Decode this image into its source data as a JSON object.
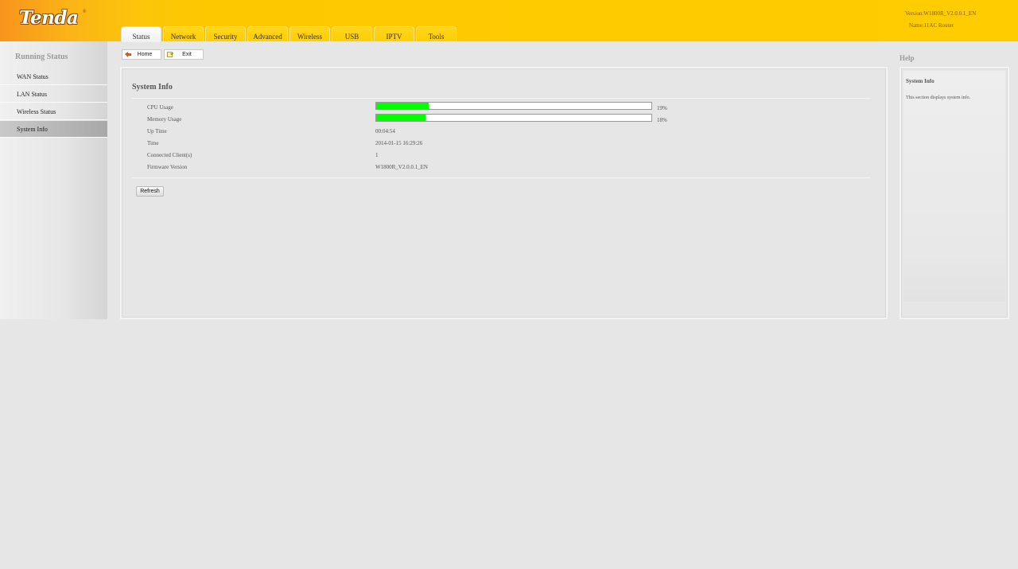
{
  "header": {
    "logo": "Tenda",
    "logo_mark": "®",
    "version": "Version:W1800R_V2.0.0.1_EN",
    "name": "Name:11AC Router"
  },
  "tabs": [
    "Status",
    "Network",
    "Security",
    "Advanced",
    "Wireless",
    "USB",
    "IPTV",
    "Tools"
  ],
  "active_tab": "Status",
  "sidebar": {
    "title": "Running Status",
    "items": [
      "WAN Status",
      "LAN Status",
      "Wireless Status",
      "System Info"
    ],
    "active": "System Info"
  },
  "toolbar": {
    "home_label": "Home",
    "exit_label": "Exit"
  },
  "main": {
    "title": "System Info",
    "cpu_label": "CPU Usage",
    "cpu_value": "19%",
    "cpu_fraction": 0.19,
    "memory_label": "Memory Usage",
    "memory_value": "18%",
    "memory_fraction": 0.18,
    "uptime_label": "Up Time",
    "uptime_value": "00:04:54",
    "time_label": "Time",
    "time_value": "2014-01-15 16:29:26",
    "clients_label": "Connected Client(s)",
    "clients_value": "1",
    "firmware_label": "Firmware Version",
    "firmware_value": "W1800R_V2.0.0.1_EN",
    "refresh_label": "Refresh"
  },
  "help": {
    "heading": "Help",
    "title": "System Info",
    "text": "This section displays system info."
  },
  "colors": {
    "header_yellow": "#ffcc00",
    "header_orange": "#f7941d",
    "usage_bar": "#00ff00",
    "background": "#e6e6e6"
  }
}
